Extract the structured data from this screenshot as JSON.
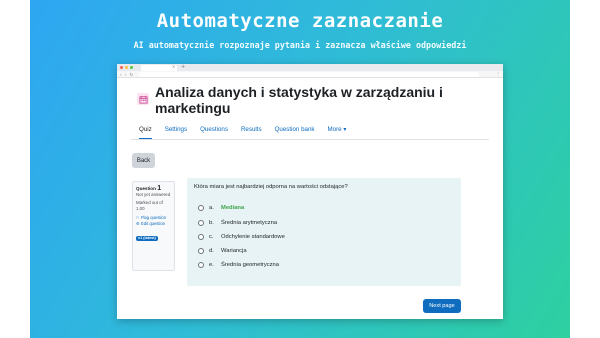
{
  "banner": {
    "headline": "Automatyczne zaznaczanie",
    "subline": "AI automatycznie rozpoznaje pytania i zaznacza właściwe odpowiedzi",
    "gradient_start": "#2ea6f2",
    "gradient_end": "#2ed0a0"
  },
  "browser": {
    "tab_close": "×",
    "tab_new": "+",
    "nav_glyphs": "‹ › ↻",
    "menu": "⋮"
  },
  "course": {
    "icon": "calendar-icon",
    "title": "Analiza danych i statystyka w zarządzaniu i marketingu"
  },
  "tabs": [
    {
      "label": "Quiz",
      "active": true
    },
    {
      "label": "Settings",
      "active": false
    },
    {
      "label": "Questions",
      "active": false
    },
    {
      "label": "Results",
      "active": false
    },
    {
      "label": "Question bank",
      "active": false
    },
    {
      "label": "More ▾",
      "active": false
    }
  ],
  "back_label": "Back",
  "question_info": {
    "label": "Question",
    "number": "1",
    "status": "Not yet answered",
    "marked": "Marked out of 1.00",
    "flag_label": "Flag question",
    "edit_label": "Edit question",
    "badge": "v1 (latest)"
  },
  "question": {
    "text": "Która miara jest najbardziej odporna na wartości odstające?",
    "options": [
      {
        "letter": "a.",
        "text": "Mediana",
        "correct": true
      },
      {
        "letter": "b.",
        "text": "Średnia arytmetyczna",
        "correct": false
      },
      {
        "letter": "c.",
        "text": "Odchylenie standardowe",
        "correct": false
      },
      {
        "letter": "d.",
        "text": "Wariancja",
        "correct": false
      },
      {
        "letter": "e.",
        "text": "Średnia geometryczna",
        "correct": false
      }
    ]
  },
  "next_label": "Next page",
  "colors": {
    "accent": "#0f6cbf",
    "correct": "#3fa54a",
    "question_bg": "#e7f3f5"
  }
}
